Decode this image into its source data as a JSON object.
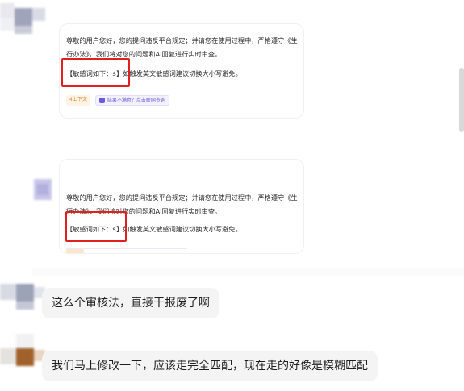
{
  "cards": [
    {
      "line1": "尊敬的用户您好，您的提问违反平台规定；并请您在使用过程中，严格遵守《生",
      "line2": "行办法》，我们将对您的问题和AI回复进行实时审查。",
      "sensitive_prefix": "【敏感词如下：",
      "sensitive_word": "s",
      "sensitive_suffix": "】如触发英文敏感词建议切换大小写避免。",
      "chips": {
        "context": "4上下文",
        "feedback": "结果不满意？点击联网查询"
      }
    },
    {
      "line1": "尊敬的用户您好，您的提问违反平台规定；并请您在使用过程中，严格遵守《生",
      "line2": "行办法》，我们将对您的问题和AI回复进行实时审查。",
      "sensitive_prefix": "【敏感词如下：",
      "sensitive_word": "s",
      "sensitive_suffix": "】如触发英文敏感词建议切换大小写避免。"
    }
  ],
  "messages": [
    {
      "text": "这么个审核法，直接干报废了啊"
    },
    {
      "text": "我们马上修改一下，应该走完全匹配，现在走的好像是模糊匹配"
    }
  ],
  "colors": {
    "highlight": "#e02020",
    "bubble_bg": "#f4f4f5"
  }
}
